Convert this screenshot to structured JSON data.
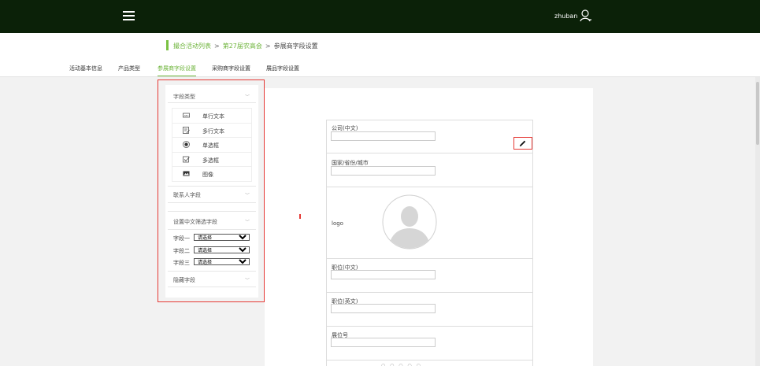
{
  "header": {
    "username": "zhuban"
  },
  "breadcrumb": {
    "items": [
      "撮合活动列表",
      "第27届农高会",
      "参展商字段设置"
    ],
    "separator": ">"
  },
  "tabs": [
    {
      "label": "活动基本信息",
      "active": false
    },
    {
      "label": "产品类型",
      "active": false
    },
    {
      "label": "参展商字段设置",
      "active": true
    },
    {
      "label": "采购商字段设置",
      "active": false
    },
    {
      "label": "展品字段设置",
      "active": false
    }
  ],
  "left_panel": {
    "field_types_title": "字段类型",
    "field_types": [
      {
        "label": "单行文本",
        "icon": "text-line-icon"
      },
      {
        "label": "多行文本",
        "icon": "text-area-icon"
      },
      {
        "label": "单选框",
        "icon": "radio-icon"
      },
      {
        "label": "多选框",
        "icon": "checkbox-icon"
      },
      {
        "label": "图像",
        "icon": "image-icon"
      }
    ],
    "contact_fields_title": "联系人字段",
    "filter_fields_title": "设置中文筛选字段",
    "filters": [
      {
        "label": "字段一",
        "value": "请选择"
      },
      {
        "label": "字段二",
        "value": "请选择"
      },
      {
        "label": "字段三",
        "value": "请选择"
      }
    ],
    "hidden_fields_title": "隐藏字段"
  },
  "form": {
    "fields": [
      {
        "label": "公司(中文)"
      },
      {
        "label": "国家/省份/城市"
      },
      {
        "label": "logo"
      },
      {
        "label": "职位(中文)"
      },
      {
        "label": "职位(英文)"
      },
      {
        "label": "展位号"
      }
    ]
  },
  "colors": {
    "topbar": "#0b2108",
    "accent": "#6fb53d",
    "highlight": "#e53935"
  }
}
